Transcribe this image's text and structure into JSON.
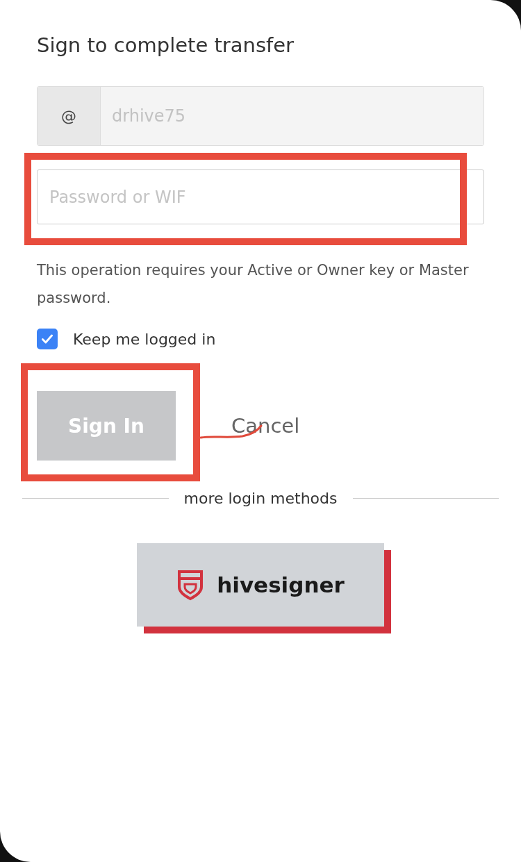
{
  "title": "Sign to complete transfer",
  "username": {
    "addon": "@",
    "value": "drhive75",
    "disabled": true
  },
  "password": {
    "placeholder": "Password or WIF",
    "highlighted": true
  },
  "help_text": "This operation requires your Active or Owner key or Master password.",
  "keep_logged_in": {
    "label": "Keep me logged in",
    "checked": true
  },
  "sign_in": {
    "label": "Sign In",
    "disabled": true,
    "highlighted": true
  },
  "cancel": {
    "label": "Cancel",
    "scribbled": true
  },
  "divider": {
    "label": "more login methods"
  },
  "hivesigner": {
    "label": "hivesigner"
  }
}
